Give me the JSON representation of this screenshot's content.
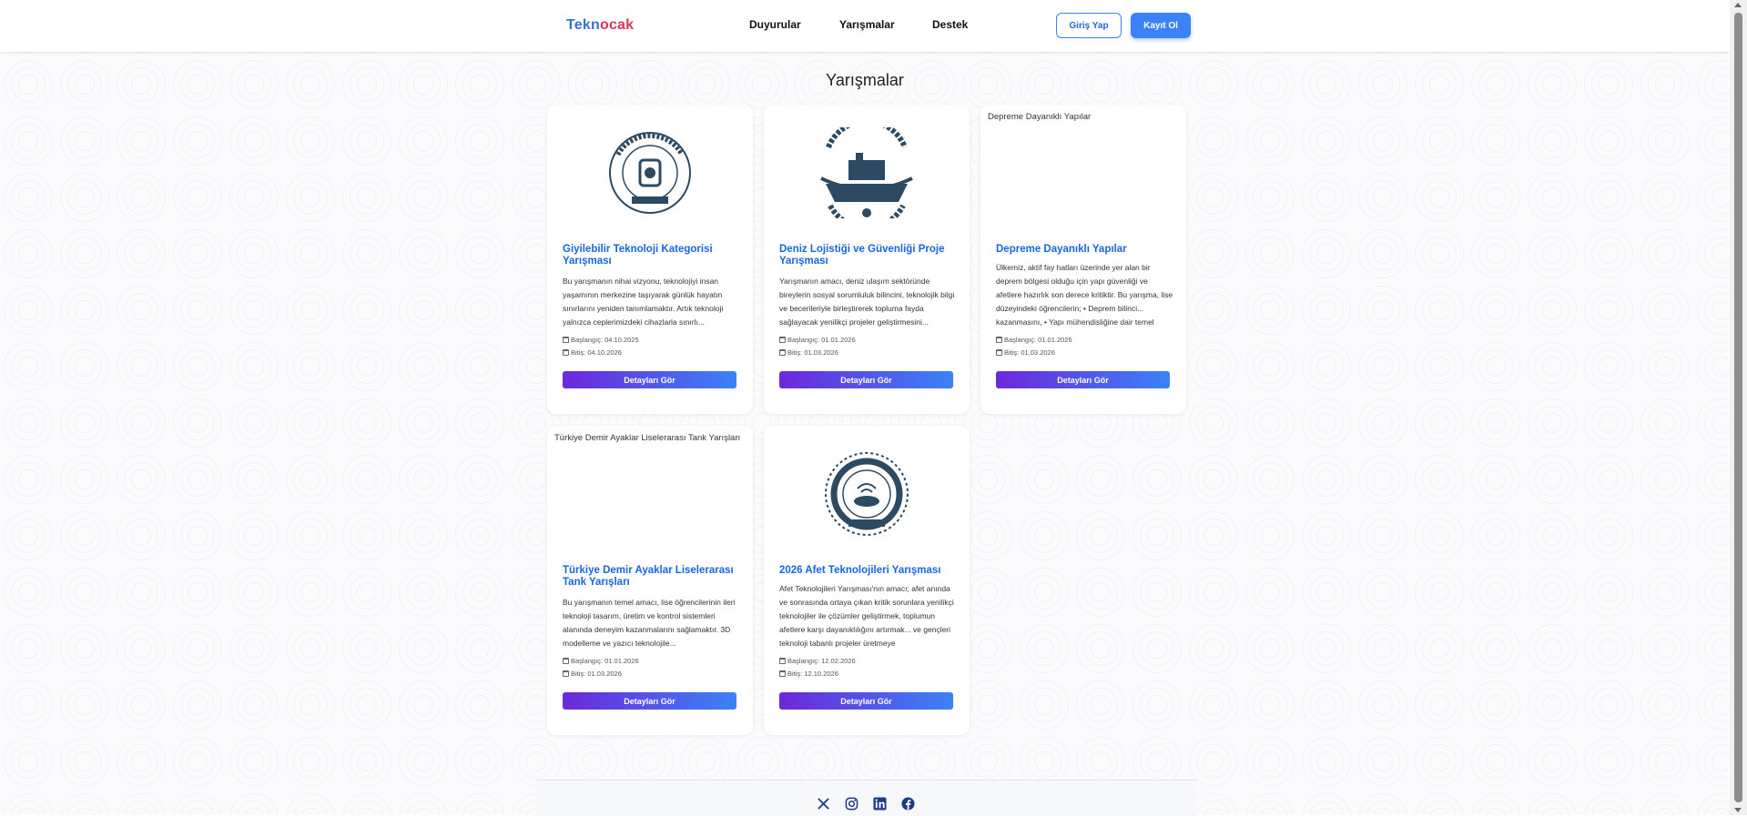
{
  "header": {
    "logo_part1": "Tekn",
    "logo_part2": "o",
    "logo_part3": "cak",
    "nav": [
      "Duyurular",
      "Yarışmalar",
      "Destek"
    ],
    "login_label": "Giriş Yap",
    "register_label": "Kayıt Ol"
  },
  "page": {
    "title": "Yarışmalar"
  },
  "cards": [
    {
      "image": "seal",
      "title": "Giyilebilir Teknoloji Kategorisi Yarışması",
      "description": "Bu yarışmanın nihai vizyonu, teknolojiyi insan yaşamının merkezine taşıyarak günlük hayatın sınırlarını yeniden tanımlamaktır. Artık teknoloji yalnızca ceplerimizdeki cihazlarla sınırlı...",
      "start": "Başlangıç: 04.10.2025",
      "end": "Bitiş: 04.10.2026",
      "button": "Detayları Gör"
    },
    {
      "image": "seal",
      "title": "Deniz Lojistiği ve Güvenliği Proje Yarışması",
      "description": "Yarışmanın amacı, deniz ulaşım sektöründe bireylerin sosyal sorumluluk bilincini, teknolojik bilgi ve becerileriyle birleştirerek topluma fayda sağlayacak yenilikçi projeler geliştirmesini...",
      "start": "Başlangıç: 01.01.2026",
      "end": "Bitiş: 01.03.2026",
      "button": "Detayları Gör"
    },
    {
      "image": "broken",
      "image_alt": "Depreme Dayanıklı Yapılar",
      "title": "Depreme Dayanıklı Yapılar",
      "description": "Ülkemiz, aktif fay hatları üzerinde yer alan bir deprem bölgesi olduğu için yapı güvenliği ve afetlere hazırlık son derece kritiktir. Bu yarışma, lise düzeyindeki öğrencilerin; • Deprem bilinci... kazanmasını, • Yapı mühendisliğine dair temel",
      "start": "Başlangıç: 01.01.2026",
      "end": "Bitiş: 01.03.2026",
      "button": "Detayları Gör"
    },
    {
      "image": "broken",
      "image_alt": "Türkiye Demir Ayaklar Liselerarası Tank Yarışları",
      "title": "Türkiye Demir Ayaklar Liselerarası Tank Yarışları",
      "description": "Bu yarışmanın temel amacı, lise öğrencilerinin ileri teknoloji tasarım, üretim ve kontrol sistemleri alanında deneyim kazanmalarını sağlamaktır. 3D modelleme ve yazıcı teknolojile...",
      "start": "Başlangıç: 01.01.2026",
      "end": "Bitiş: 01.03.2026",
      "button": "Detayları Gör"
    },
    {
      "image": "seal",
      "title": "2026 Afet Teknolojileri Yarışması",
      "description": "Afet Teknolojileri Yarışması'nın amacı; afet anında ve sonrasında ortaya çıkan kritik sorunlara yenilikçi teknolojiler ile çözümler geliştirmek, toplumun afetlere karşı dayanıklılığını artırmak... ve gençleri teknoloji tabanlı projeler üretmeye",
      "start": "Başlangıç: 12.02.2026",
      "end": "Bitiş: 12.10.2026",
      "button": "Detayları Gör"
    }
  ],
  "footer": {
    "social": [
      "x-icon",
      "instagram-icon",
      "linkedin-icon",
      "facebook-icon"
    ]
  },
  "colors": {
    "accent": "#3b82f6",
    "title_blue": "#1766e0",
    "button_gradient_start": "#6d28d9",
    "button_gradient_end": "#3b82f6"
  }
}
